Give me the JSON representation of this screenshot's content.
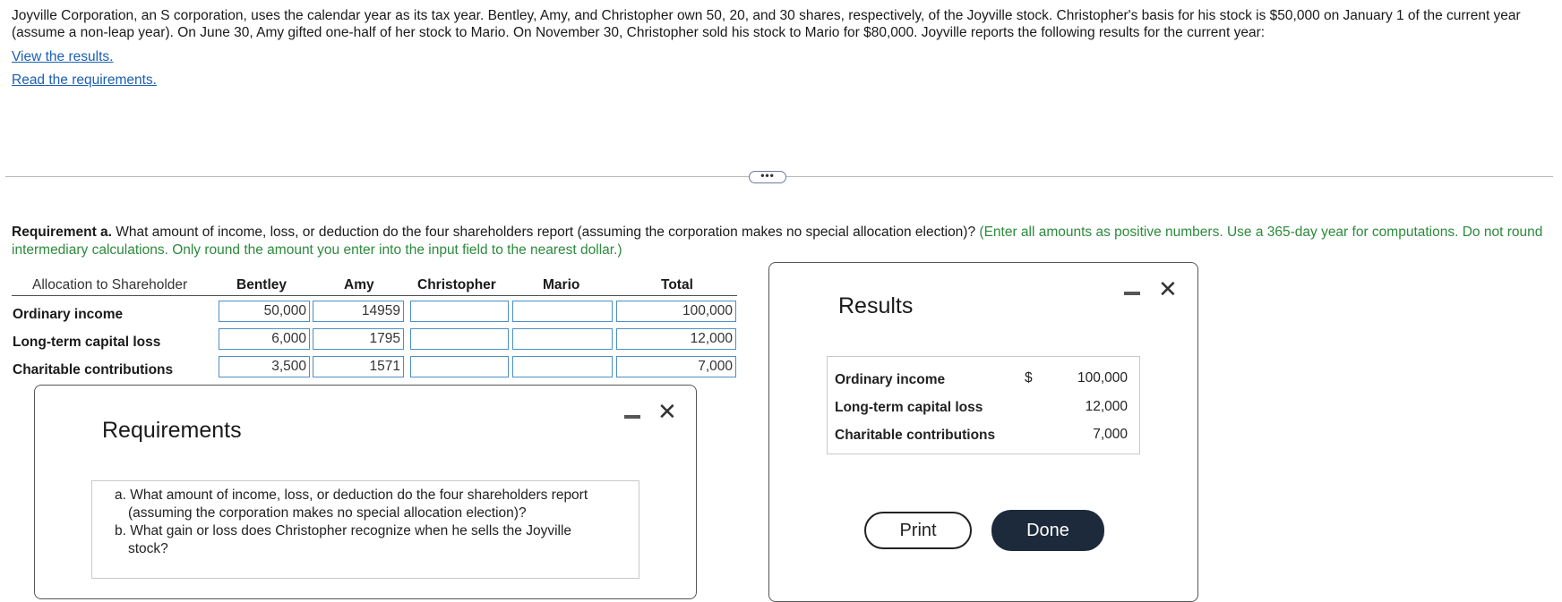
{
  "problem": {
    "text": "Joyville Corporation, an S corporation, uses the calendar year as its tax year. Bentley, Amy, and Christopher own 50, 20, and 30 shares, respectively, of the Joyville stock. Christopher's basis for his stock is $50,000 on January 1 of the current year (assume a non-leap year). On June 30, Amy gifted one-half of her stock to Mario. On November 30, Christopher sold his stock to Mario for $80,000. Joyville reports the following results for the current year:",
    "view_results_link": "View the results.",
    "read_requirements_link": "Read the requirements."
  },
  "divider_dots": "•••",
  "requirement": {
    "label": "Requirement a.",
    "question": " What amount of income, loss, or deduction do the four shareholders report (assuming the corporation makes no special allocation election)? ",
    "instruction": "(Enter all amounts as positive numbers. Use a 365-day year for computations. Do not round intermediary calculations. Only round the amount you enter into the input field to the nearest dollar.)"
  },
  "table": {
    "headers": {
      "allocation": "Allocation to Shareholder",
      "bentley": "Bentley",
      "amy": "Amy",
      "christopher": "Christopher",
      "mario": "Mario",
      "total": "Total"
    },
    "rows": [
      {
        "label": "Ordinary income",
        "bentley": "50,000",
        "amy": "14959",
        "christopher": "",
        "mario": "",
        "total": "100,000"
      },
      {
        "label": "Long-term capital loss",
        "bentley": "6,000",
        "amy": "1795",
        "christopher": "",
        "mario": "",
        "total": "12,000"
      },
      {
        "label": "Charitable contributions",
        "bentley": "3,500",
        "amy": "1571",
        "christopher": "",
        "mario": "",
        "total": "7,000"
      }
    ]
  },
  "requirements_modal": {
    "title": "Requirements",
    "items": [
      "a. What amount of income, loss, or deduction do the four shareholders report (assuming the corporation makes no special allocation election)?",
      "b. What gain or loss does Christopher recognize when he sells the Joyville stock?"
    ],
    "close": "✕"
  },
  "results_modal": {
    "title": "Results",
    "currency": "$",
    "rows": [
      {
        "label": "Ordinary income",
        "value": "100,000"
      },
      {
        "label": "Long-term capital loss",
        "value": "12,000"
      },
      {
        "label": "Charitable contributions",
        "value": "7,000"
      }
    ],
    "print_label": "Print",
    "done_label": "Done",
    "close": "✕"
  }
}
